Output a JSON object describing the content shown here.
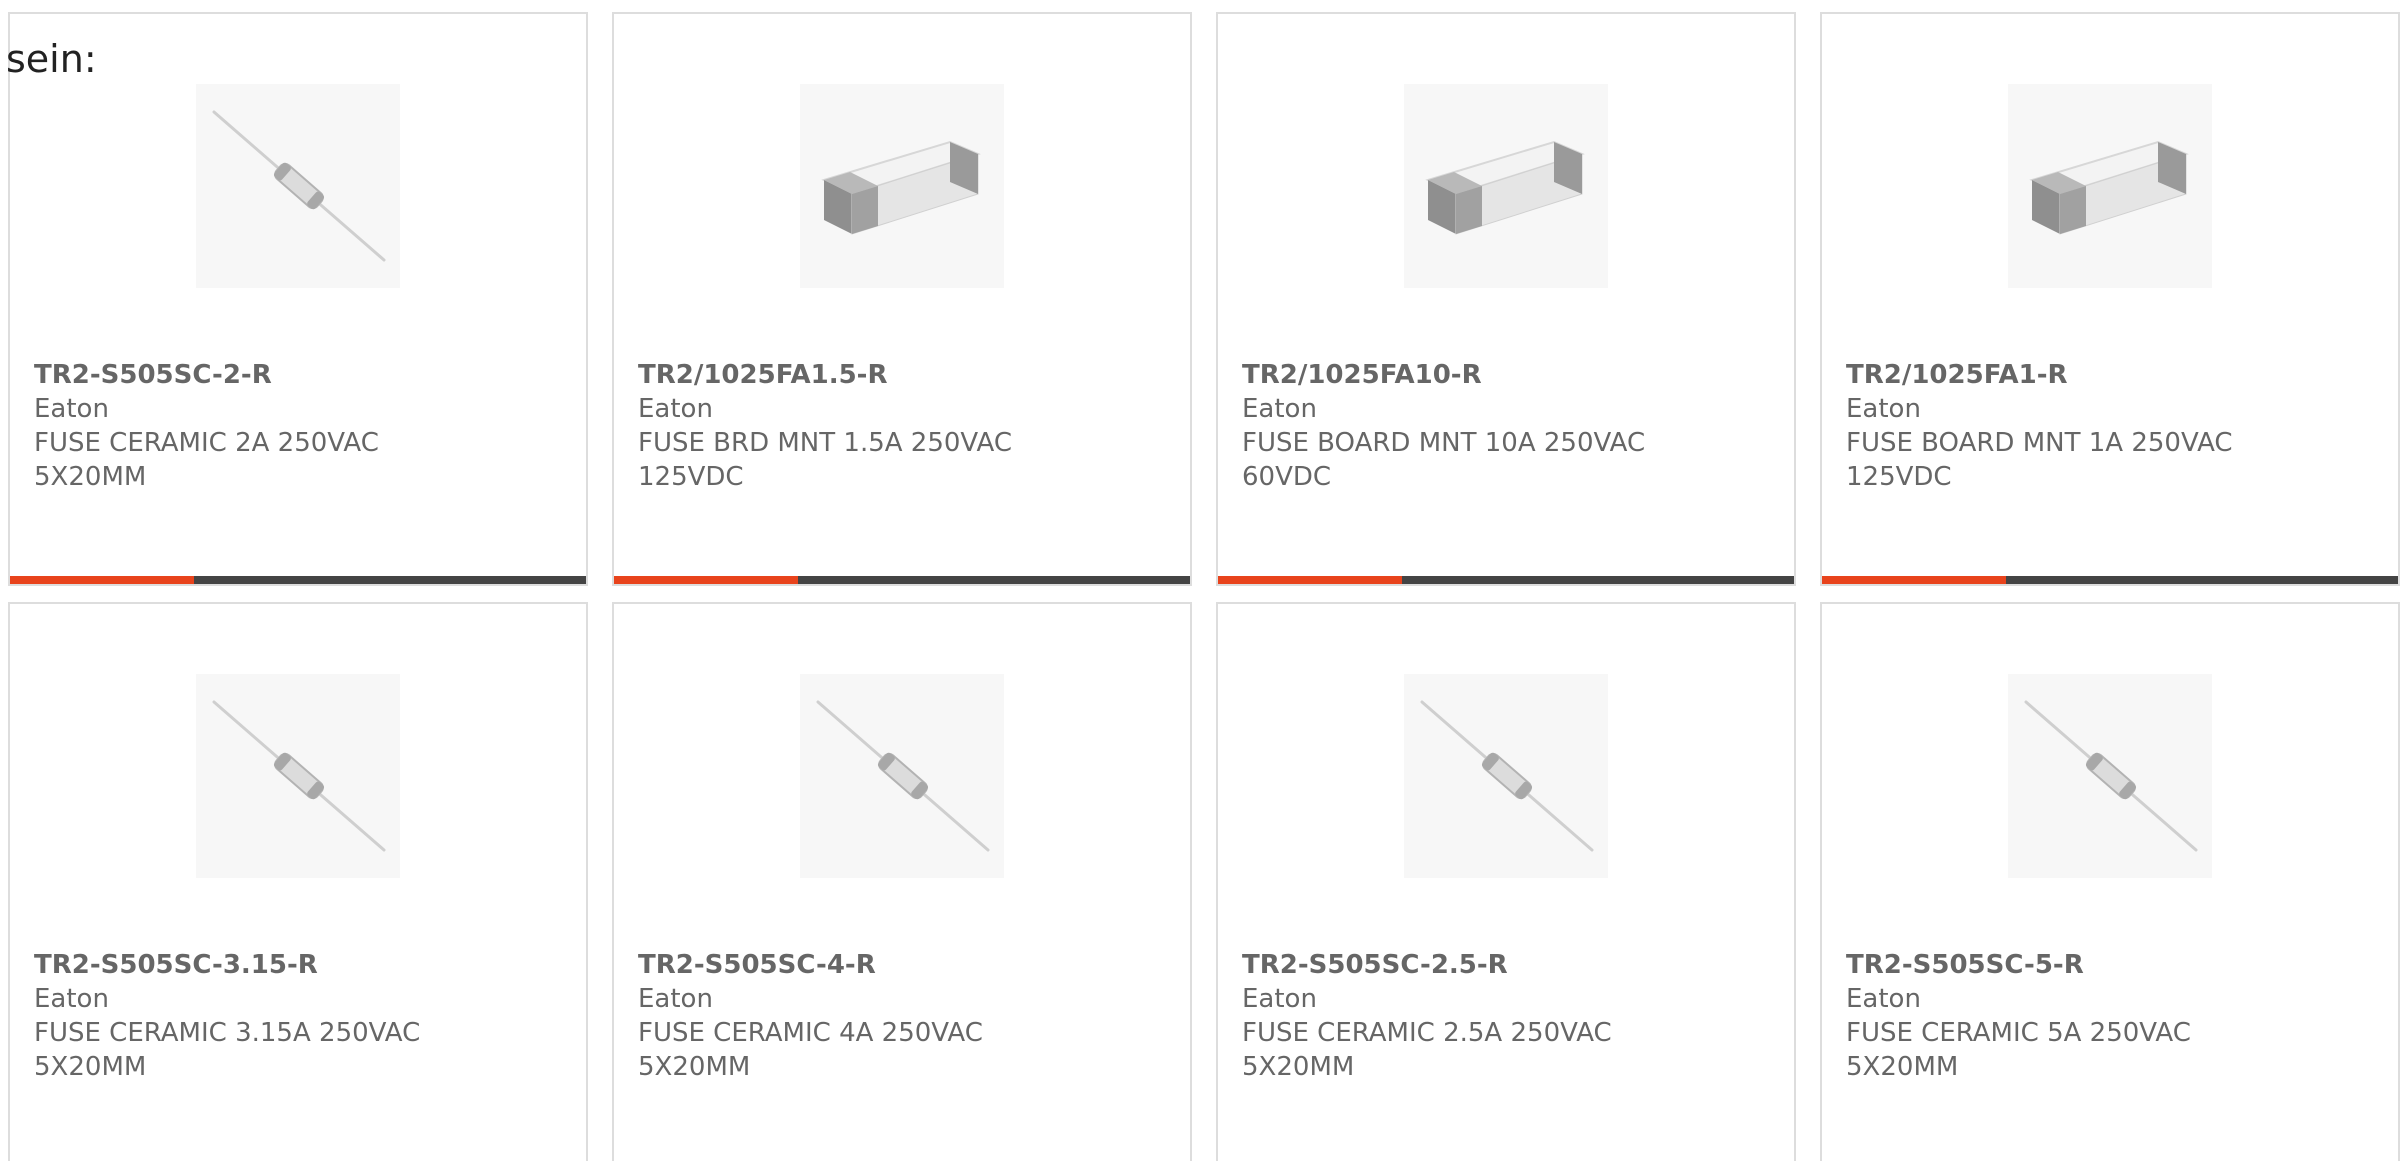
{
  "intro": "sein:",
  "colors": {
    "accent": "#e8431c",
    "bar": "#444444",
    "card_border": "#dddddd",
    "text": "#666666"
  },
  "products": [
    {
      "part": "TR2-S505SC-2-R",
      "maker": "Eaton",
      "desc1": "FUSE CERAMIC 2A 250VAC",
      "desc2": "5X20MM",
      "image": "axial-fuse-icon",
      "has_bar": true,
      "bar_fill": 0.32
    },
    {
      "part": "TR2/1025FA1.5-R",
      "maker": "Eaton",
      "desc1": "FUSE BRD MNT 1.5A 250VAC",
      "desc2": "125VDC",
      "image": "smd-fuse-icon",
      "has_bar": true,
      "bar_fill": 0.32
    },
    {
      "part": "TR2/1025FA10-R",
      "maker": "Eaton",
      "desc1": "FUSE BOARD MNT 10A 250VAC",
      "desc2": "60VDC",
      "image": "smd-fuse-icon",
      "has_bar": true,
      "bar_fill": 0.32
    },
    {
      "part": "TR2/1025FA1-R",
      "maker": "Eaton",
      "desc1": "FUSE BOARD MNT 1A 250VAC",
      "desc2": "125VDC",
      "image": "smd-fuse-icon",
      "has_bar": true,
      "bar_fill": 0.32
    },
    {
      "part": "TR2-S505SC-3.15-R",
      "maker": "Eaton",
      "desc1": "FUSE CERAMIC 3.15A 250VAC",
      "desc2": "5X20MM",
      "image": "axial-fuse-icon",
      "has_bar": false
    },
    {
      "part": "TR2-S505SC-4-R",
      "maker": "Eaton",
      "desc1": "FUSE CERAMIC 4A 250VAC",
      "desc2": "5X20MM",
      "image": "axial-fuse-icon",
      "has_bar": false
    },
    {
      "part": "TR2-S505SC-2.5-R",
      "maker": "Eaton",
      "desc1": "FUSE CERAMIC 2.5A 250VAC",
      "desc2": "5X20MM",
      "image": "axial-fuse-icon",
      "has_bar": false
    },
    {
      "part": "TR2-S505SC-5-R",
      "maker": "Eaton",
      "desc1": "FUSE CERAMIC 5A 250VAC",
      "desc2": "5X20MM",
      "image": "axial-fuse-icon",
      "has_bar": false
    }
  ]
}
